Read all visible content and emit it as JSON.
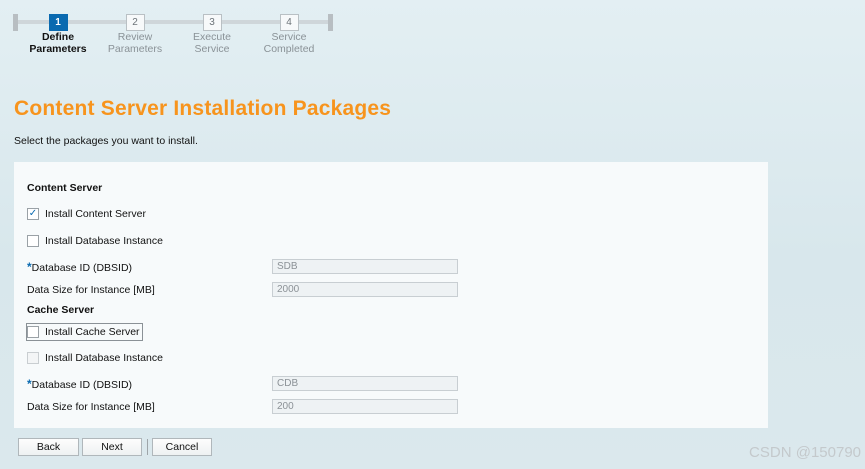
{
  "wizard": {
    "steps": [
      {
        "number": "1",
        "line1": "Define",
        "line2": "Parameters",
        "active": true
      },
      {
        "number": "2",
        "line1": "Review",
        "line2": "Parameters",
        "active": false
      },
      {
        "number": "3",
        "line1": "Execute",
        "line2": "Service",
        "active": false
      },
      {
        "number": "4",
        "line1": "Service",
        "line2": "Completed",
        "active": false
      }
    ]
  },
  "page": {
    "title": "Content Server Installation Packages",
    "subtitle": "Select the packages you want to install."
  },
  "content_server": {
    "section_title": "Content Server",
    "install_content_server": {
      "label": "Install Content Server",
      "checked": true
    },
    "install_db_instance": {
      "label": "Install Database Instance",
      "checked": false
    },
    "db_id": {
      "required_mark": "*",
      "label": "Database ID (DBSID)",
      "value": "SDB"
    },
    "db_size": {
      "label": "Data Size for Instance [MB]",
      "value": "2000"
    }
  },
  "cache_server": {
    "section_title": "Cache Server",
    "install_cache_server": {
      "label": "Install Cache Server",
      "checked": false
    },
    "install_db_instance": {
      "label": "Install Database Instance",
      "checked": false,
      "disabled": true
    },
    "db_id": {
      "required_mark": "*",
      "label": "Database ID (DBSID)",
      "value": "CDB"
    },
    "db_size": {
      "label": "Data Size for Instance [MB]",
      "value": "200"
    }
  },
  "buttons": {
    "back": "Back",
    "next": "Next",
    "cancel": "Cancel"
  },
  "watermark": "CSDN @150790",
  "colors": {
    "title_orange": "#f7941d",
    "active_step_blue": "#0a6ab0"
  }
}
